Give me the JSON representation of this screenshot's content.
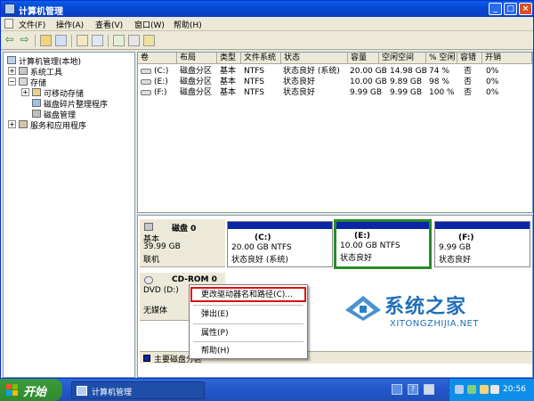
{
  "window": {
    "title": "计算机管理"
  },
  "titlebar_buttons": {
    "minimize": "_",
    "maximize": "□",
    "close": "×"
  },
  "menu": [
    "文件(F)",
    "操作(A)",
    "查看(V)",
    "窗口(W)",
    "帮助(H)"
  ],
  "toolbar": {
    "back": "⇦",
    "forward": "⇨"
  },
  "tree": {
    "root": "计算机管理(本地)",
    "system_tools": "系统工具",
    "storage": "存储",
    "removable": "可移动存储",
    "defrag": "磁盘碎片整理程序",
    "disk_mgmt": "磁盘管理",
    "services": "服务和应用程序"
  },
  "columns": [
    "卷",
    "布局",
    "类型",
    "文件系统",
    "状态",
    "容量",
    "空闲空间",
    "% 空闲",
    "容错",
    "开销"
  ],
  "volumes": [
    [
      "(C:)",
      "磁盘分区",
      "基本",
      "NTFS",
      "状态良好 (系统)",
      "20.00 GB",
      "14.98 GB",
      "74 %",
      "否",
      "0%"
    ],
    [
      "(E:)",
      "磁盘分区",
      "基本",
      "NTFS",
      "状态良好",
      "10.00 GB",
      "9.89 GB",
      "98 %",
      "否",
      "0%"
    ],
    [
      "(F:)",
      "磁盘分区",
      "基本",
      "NTFS",
      "状态良好",
      "9.99 GB",
      "9.99 GB",
      "100 %",
      "否",
      "0%"
    ]
  ],
  "disk0": {
    "name": "磁盘 0",
    "type": "基本",
    "size": "39.99 GB",
    "status": "联机",
    "partitions": [
      {
        "label": "(C:)",
        "info": "20.00 GB NTFS",
        "status": "状态良好 (系统)"
      },
      {
        "label": "(E:)",
        "info": "10.00 GB NTFS",
        "status": "状态良好"
      },
      {
        "label": "(F:)",
        "info": "9.99 GB",
        "status": "状态良好"
      }
    ]
  },
  "cdrom": {
    "name": "CD-ROM 0",
    "type": "DVD (D:)",
    "status": "无媒体"
  },
  "legend": {
    "primary": "主要磁盘分区"
  },
  "context_menu": {
    "change_letter": "更改驱动器名和路径(C)...",
    "eject": "弹出(E)",
    "properties": "属性(P)",
    "help": "帮助(H)"
  },
  "watermark": {
    "big": "系统之家",
    "small": "XITONGZHIJIA.NET"
  },
  "taskbar": {
    "start": "开始",
    "task": "计算机管理",
    "clock": "20:56"
  },
  "colors": {
    "primary_partition": "#0a26a5",
    "selected_outline": "#2a8a2a",
    "highlight_box": "#e01010"
  }
}
